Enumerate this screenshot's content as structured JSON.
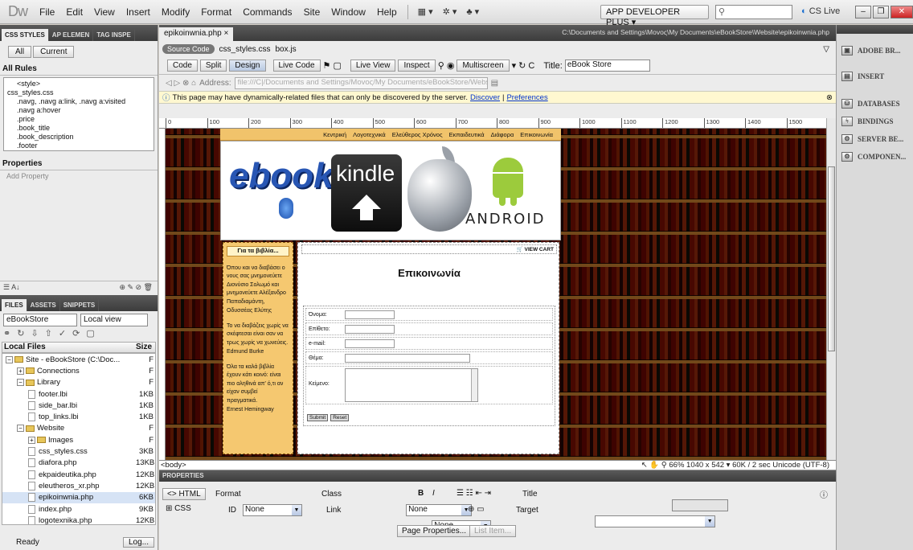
{
  "app": {
    "logo": "Dw"
  },
  "menu": [
    "File",
    "Edit",
    "View",
    "Insert",
    "Modify",
    "Format",
    "Commands",
    "Site",
    "Window",
    "Help"
  ],
  "workspace": "APP DEVELOPER PLUS ▾",
  "cslive": "CS Live",
  "left": {
    "tabs": [
      "CSS STYLES",
      "AP ELEMEN",
      "TAG INSPE"
    ],
    "mode_all": "All",
    "mode_current": "Current",
    "all_rules": "All Rules",
    "rules": [
      "<style>",
      "css_styles.css",
      "  .navg, .navg a:link, .navg a:visited",
      "  .navg a:hover",
      "  .price",
      "  .book_title",
      "  .book_description",
      "  .footer"
    ],
    "properties": "Properties",
    "add_property": "Add Property",
    "files_tabs": [
      "FILES",
      "ASSETS",
      "SNIPPETS"
    ],
    "site_select": "eBookStore",
    "view_select": "Local view",
    "col_local": "Local Files",
    "col_size": "Size",
    "files": [
      {
        "name": "Site - eBookStore (C:\\Doc...",
        "size": "F",
        "indent": 0,
        "type": "folder",
        "exp": "−"
      },
      {
        "name": "Connections",
        "size": "F",
        "indent": 1,
        "type": "folder",
        "exp": "+"
      },
      {
        "name": "Library",
        "size": "F",
        "indent": 1,
        "type": "folder",
        "exp": "−"
      },
      {
        "name": "footer.lbi",
        "size": "1KB",
        "indent": 2,
        "type": "file"
      },
      {
        "name": "side_bar.lbi",
        "size": "1KB",
        "indent": 2,
        "type": "file"
      },
      {
        "name": "top_links.lbi",
        "size": "1KB",
        "indent": 2,
        "type": "file"
      },
      {
        "name": "Website",
        "size": "F",
        "indent": 1,
        "type": "folder",
        "exp": "−"
      },
      {
        "name": "Images",
        "size": "F",
        "indent": 2,
        "type": "folder",
        "exp": "+"
      },
      {
        "name": "css_styles.css",
        "size": "3KB",
        "indent": 2,
        "type": "file"
      },
      {
        "name": "diafora.php",
        "size": "13KB",
        "indent": 2,
        "type": "file"
      },
      {
        "name": "ekpaideutika.php",
        "size": "12KB",
        "indent": 2,
        "type": "file"
      },
      {
        "name": "eleutheros_xr.php",
        "size": "12KB",
        "indent": 2,
        "type": "file"
      },
      {
        "name": "epikoinwnia.php",
        "size": "6KB",
        "indent": 2,
        "type": "file",
        "hl": true
      },
      {
        "name": "index.php",
        "size": "9KB",
        "indent": 2,
        "type": "file"
      },
      {
        "name": "logotexnika.php",
        "size": "12KB",
        "indent": 2,
        "type": "file"
      }
    ],
    "status": "Ready",
    "log": "Log..."
  },
  "doc": {
    "tab": "epikoinwnia.php ×",
    "path": "C:\\Documents and Settings\\Movoς\\My Documents\\eBookStore\\Website\\epikoinwnia.php",
    "source_code": "Source Code",
    "related": [
      "css_styles.css",
      "box.js"
    ],
    "btn_code": "Code",
    "btn_split": "Split",
    "btn_design": "Design",
    "btn_livecode": "Live Code",
    "btn_liveview": "Live View",
    "btn_inspect": "Inspect",
    "btn_multiscreen": "Multiscreen",
    "title_label": "Title:",
    "title_value": "eBook Store",
    "address_label": "Address:",
    "address_value": "file:///C|/Documents and Settings/Movoς/My Documents/eBookStore/Website/",
    "info": "This page may have dynamically-related files that can only be discovered by the server.",
    "info_discover": "Discover",
    "info_prefs": "Preferences",
    "ruler": [
      "0",
      "100",
      "200",
      "300",
      "400",
      "500",
      "600",
      "700",
      "800",
      "900",
      "1000",
      "1100",
      "1200",
      "1300",
      "1400",
      "1500"
    ],
    "tag": "<body>",
    "zoom": "66%",
    "status_right": "1040 x 542 ▾  60K / 2 sec  Unicode (UTF-8)"
  },
  "site": {
    "nav": [
      "Κεντρική",
      "Λογοτεχνικά",
      "Ελεύθερος Χρόνος",
      "Εκπαιδευτικά",
      "Διάφορα",
      "Επικοινωνία"
    ],
    "ebook": "ebook",
    "kindle": "kindle",
    "android": "ANDROID",
    "sidebar_title": "Για τα βιβλία...",
    "sidebar_quotes": [
      {
        "text": "Όπου και να διαβάσει ο νους σας μνημονεύετε Διονύσιο Σολωμό και μνημονεύετε Αλέξανδρο Παπαδιαμάντη,",
        "author": "Οδυσσέας Ελύτης"
      },
      {
        "text": "Το να διαβάζεις χωρίς να σκέφτεσαι είναι σαν να τρως χωρίς να χωνεύεις.",
        "author": "Edmund Burke"
      },
      {
        "text": "Όλα τα καλά βιβλία έχουν κάτι κοινό: είναι πιο αληθινά απ' ό,τι αν είχαν συμβεί πραγματικά.",
        "author": "Ernest Hemingway"
      }
    ],
    "view_cart": "VIEW CART",
    "contact_title": "Επικοινωνία",
    "form_labels": [
      "Όνομα:",
      "Επίθετο:",
      "e-mail:",
      "Θέμα:",
      "Κείμενο:"
    ],
    "submit": "Submit",
    "reset": "Reset"
  },
  "props": {
    "title": "PROPERTIES",
    "html": "<> HTML",
    "css": "CSS",
    "format_label": "Format",
    "format_value": "None",
    "class_label": "Class",
    "class_value": "None",
    "id_label": "ID",
    "id_value": "None",
    "link_label": "Link",
    "title_label": "Title",
    "target_label": "Target",
    "bold": "B",
    "italic": "I",
    "page_properties": "Page Properties...",
    "list_item": "List Item..."
  },
  "right": {
    "items": [
      "ADOBE BR...",
      "INSERT",
      "DATABASES",
      "BINDINGS",
      "SERVER BE...",
      "COMPONEN..."
    ]
  }
}
